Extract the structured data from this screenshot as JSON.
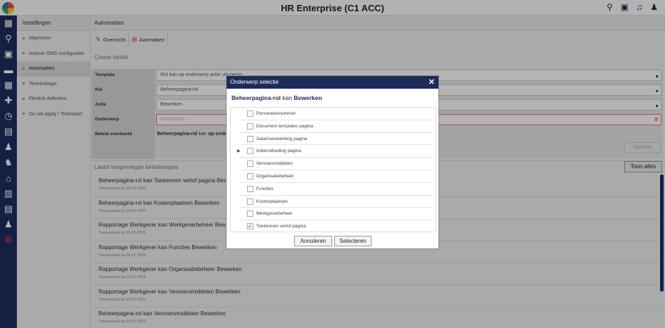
{
  "app": {
    "title": "HR Enterprise (C1 ACC)"
  },
  "top_icons": [
    "search-gear-icon",
    "document-icon",
    "bell-icon",
    "user-icon"
  ],
  "rail": [
    {
      "icon": "grid-icon",
      "glyph": "▦"
    },
    {
      "icon": "search-icon",
      "glyph": "⚲"
    },
    {
      "icon": "briefcase-icon",
      "glyph": "▣"
    },
    {
      "icon": "folder-icon",
      "glyph": "▬"
    },
    {
      "icon": "calendar-icon",
      "glyph": "▦"
    },
    {
      "icon": "medical-icon",
      "glyph": "✚"
    },
    {
      "icon": "timer-icon",
      "glyph": "◷"
    },
    {
      "icon": "id-card-icon",
      "glyph": "▤"
    },
    {
      "icon": "person-icon",
      "glyph": "♟"
    },
    {
      "icon": "people-icon",
      "glyph": "♞"
    },
    {
      "icon": "bank-icon",
      "glyph": "⌂"
    },
    {
      "icon": "clipboard-icon",
      "glyph": "▥"
    },
    {
      "icon": "report-icon",
      "glyph": "▤"
    },
    {
      "icon": "user-settings-icon",
      "glyph": "♟"
    },
    {
      "icon": "settings-icon",
      "glyph": "⚙"
    }
  ],
  "sidebar": {
    "title": "Instellingen",
    "items": [
      {
        "label": "Algemeen"
      },
      {
        "label": "Actieve DMS configuratie"
      },
      {
        "label": "Autorisaties"
      },
      {
        "label": "Terminologie"
      },
      {
        "label": "Flexlink definities"
      },
      {
        "label": "Do not apply / Testreport"
      }
    ]
  },
  "main": {
    "title": "Autorisaties",
    "toolbar": {
      "overview": "Overzicht",
      "create": "Aanmaken"
    },
    "create_title": "Creeer beleid",
    "form": {
      "template_label": "Template",
      "template_value": "Rol kan op onderwerp actie uitvoeren",
      "rol_label": "Rol",
      "rol_value": "Beheerpagina-rol",
      "actie_label": "Actie",
      "actie_value": "Bewerken",
      "onderwerp_label": "Onderwerp",
      "onderwerp_placeholder": "Onderwerp",
      "voorbeeld_label": "Beleid voorbeeld",
      "voorbeeld_role": "Beheerpagina-rol",
      "voorbeeld_kan": " kan ",
      "voorbeeld_rest": "op onde",
      "save": "Opslaan"
    },
    "recent_title": "Laatst toegevoegde beleidsregels",
    "show_all": "Toon alles",
    "rules": [
      {
        "text": "Beheerpagina-rol kan Toekennen verlof pagina Bewerken",
        "added": "Toegevoegd op 18-03-2025"
      },
      {
        "text": "Beheerpagina-rol kan Kostenplaatsen Bewerken",
        "added": "Toegevoegd op 10-03-2025"
      },
      {
        "text": "Rapportage Werkgever kan Werkgeverbeheer Bewerken",
        "added": "Toegevoegd op 28-01-2025"
      },
      {
        "text": "Rapportage Werkgever kan Functies Bewerken",
        "added": "Toegevoegd op 28-01-2025"
      },
      {
        "text": "Rapportage Werkgever kan Organisatiebeheer Bewerken",
        "added": "Toegevoegd op 28-01-2025"
      },
      {
        "text": "Rapportage Werkgever kan Vervoersmiddelen Bewerken",
        "added": "Toegevoegd op 28-01-2025"
      },
      {
        "text": "Beheerpagina-rol kan Vervoersmiddelen Bewerken",
        "added": "Toegevoegd op 28-01-2025"
      }
    ]
  },
  "modal": {
    "title": "Onderwerp selectie",
    "role": "Beheerpagina-rol",
    "kan": "kan",
    "action": "Bewerken",
    "options": [
      {
        "label": "Personeelsnummer",
        "checked": false,
        "expandable": false
      },
      {
        "label": "Document templates pagina",
        "checked": false,
        "expandable": false
      },
      {
        "label": "Salarisverwerking pagina",
        "checked": false,
        "expandable": false
      },
      {
        "label": "Indiensttreding pagina",
        "checked": false,
        "expandable": true
      },
      {
        "label": "Vervoersmiddelen",
        "checked": false,
        "expandable": false
      },
      {
        "label": "Organisatiebeheer",
        "checked": false,
        "expandable": false
      },
      {
        "label": "Functies",
        "checked": false,
        "expandable": false
      },
      {
        "label": "Kostenplaatsen",
        "checked": false,
        "expandable": false
      },
      {
        "label": "Werkgeverbeheer",
        "checked": false,
        "expandable": false
      },
      {
        "label": "Toekennen verlof pagina",
        "checked": true,
        "expandable": false
      }
    ],
    "cancel": "Annuleren",
    "select": "Selecteren"
  }
}
